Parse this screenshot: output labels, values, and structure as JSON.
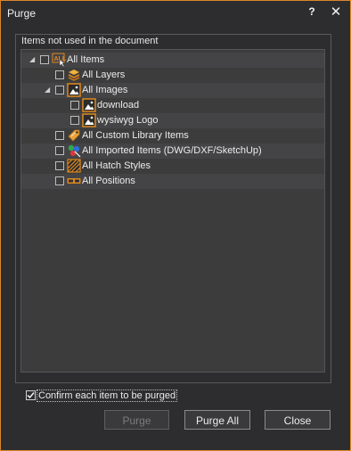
{
  "window": {
    "title": "Purge",
    "help_label": "?",
    "close_label": "✕"
  },
  "group": {
    "label": "Items not used in the document"
  },
  "tree": [
    {
      "label": "All Items",
      "icon": "all-items-icon",
      "expanded": true,
      "checked": false
    },
    {
      "label": "All Layers",
      "icon": "layers-icon",
      "checked": false
    },
    {
      "label": "All Images",
      "icon": "image-icon",
      "expanded": true,
      "checked": false
    },
    {
      "label": "download",
      "icon": "image-icon",
      "checked": false
    },
    {
      "label": "wysiwyg Logo",
      "icon": "image-icon",
      "checked": false
    },
    {
      "label": "All Custom Library Items",
      "icon": "library-tag-icon",
      "checked": false
    },
    {
      "label": "All Imported Items (DWG/DXF/SketchUp)",
      "icon": "imported-items-icon",
      "checked": false
    },
    {
      "label": "All Hatch Styles",
      "icon": "hatch-icon",
      "checked": false
    },
    {
      "label": "All Positions",
      "icon": "position-icon",
      "checked": false
    }
  ],
  "confirm": {
    "label": "Confirm each item to be purged",
    "checked": true
  },
  "buttons": {
    "purge": "Purge",
    "purge_all": "Purge All",
    "close": "Close"
  },
  "colors": {
    "accent": "#d8862a",
    "background": "#2d2d30",
    "tree_bg": "#3c3c3c",
    "icon_orange": "#e0891e"
  }
}
